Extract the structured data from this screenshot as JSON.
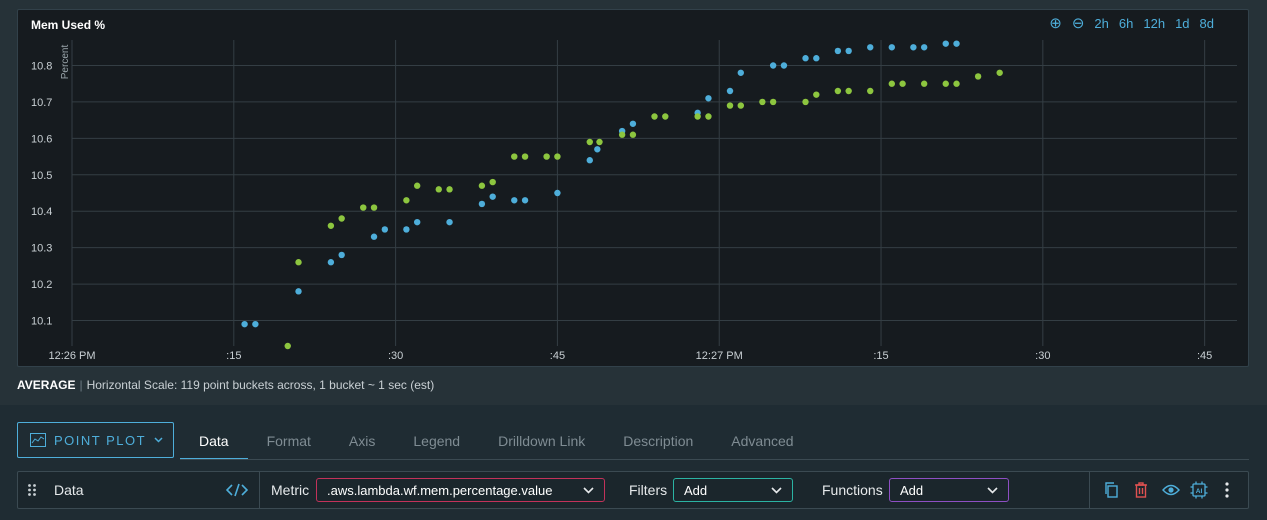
{
  "chart": {
    "title": "Mem Used %",
    "range_buttons": [
      "2h",
      "6h",
      "12h",
      "1d",
      "8d"
    ]
  },
  "chart_data": {
    "type": "scatter",
    "ylabel": "Percent",
    "xlabel": "",
    "ylim": [
      10.03,
      10.87
    ],
    "y_ticks": [
      10.1,
      10.2,
      10.3,
      10.4,
      10.5,
      10.6,
      10.7,
      10.8
    ],
    "x_range_seconds": [
      0,
      108
    ],
    "x_ticks": [
      {
        "t": 0,
        "label": "12:26 PM"
      },
      {
        "t": 15,
        "label": ":15"
      },
      {
        "t": 30,
        "label": ":30"
      },
      {
        "t": 45,
        "label": ":45"
      },
      {
        "t": 60,
        "label": "12:27 PM"
      },
      {
        "t": 75,
        "label": ":15"
      },
      {
        "t": 90,
        "label": ":30"
      },
      {
        "t": 105,
        "label": ":45"
      }
    ],
    "grid": true,
    "series": [
      {
        "color": "#4eaeda",
        "points": [
          [
            16,
            10.09
          ],
          [
            17,
            10.09
          ],
          [
            21,
            10.18
          ],
          [
            24,
            10.26
          ],
          [
            25,
            10.28
          ],
          [
            28,
            10.33
          ],
          [
            29,
            10.35
          ],
          [
            31,
            10.35
          ],
          [
            32,
            10.37
          ],
          [
            35,
            10.37
          ],
          [
            38,
            10.42
          ],
          [
            39,
            10.44
          ],
          [
            41,
            10.43
          ],
          [
            42,
            10.43
          ],
          [
            45,
            10.45
          ],
          [
            48,
            10.54
          ],
          [
            48.7,
            10.57
          ],
          [
            51,
            10.62
          ],
          [
            52,
            10.64
          ],
          [
            58,
            10.67
          ],
          [
            59,
            10.71
          ],
          [
            61,
            10.73
          ],
          [
            62,
            10.78
          ],
          [
            65,
            10.8
          ],
          [
            66,
            10.8
          ],
          [
            68,
            10.82
          ],
          [
            69,
            10.82
          ],
          [
            71,
            10.84
          ],
          [
            72,
            10.84
          ],
          [
            74,
            10.85
          ],
          [
            76,
            10.85
          ],
          [
            78,
            10.85
          ],
          [
            79,
            10.85
          ],
          [
            81,
            10.86
          ],
          [
            82,
            10.86
          ]
        ]
      },
      {
        "color": "#8dc63f",
        "points": [
          [
            20,
            10.03
          ],
          [
            21,
            10.26
          ],
          [
            24,
            10.36
          ],
          [
            25,
            10.38
          ],
          [
            27,
            10.41
          ],
          [
            28,
            10.41
          ],
          [
            31,
            10.43
          ],
          [
            32,
            10.47
          ],
          [
            34,
            10.46
          ],
          [
            35,
            10.46
          ],
          [
            38,
            10.47
          ],
          [
            39,
            10.48
          ],
          [
            41,
            10.55
          ],
          [
            42,
            10.55
          ],
          [
            44,
            10.55
          ],
          [
            45,
            10.55
          ],
          [
            48,
            10.59
          ],
          [
            48.9,
            10.59
          ],
          [
            51,
            10.61
          ],
          [
            52,
            10.61
          ],
          [
            54,
            10.66
          ],
          [
            55,
            10.66
          ],
          [
            58,
            10.66
          ],
          [
            59,
            10.66
          ],
          [
            61,
            10.69
          ],
          [
            62,
            10.69
          ],
          [
            64,
            10.7
          ],
          [
            65,
            10.7
          ],
          [
            68,
            10.7
          ],
          [
            69,
            10.72
          ],
          [
            71,
            10.73
          ],
          [
            72,
            10.73
          ],
          [
            74,
            10.73
          ],
          [
            76,
            10.75
          ],
          [
            77,
            10.75
          ],
          [
            79,
            10.75
          ],
          [
            81,
            10.75
          ],
          [
            82,
            10.75
          ],
          [
            84,
            10.77
          ],
          [
            86,
            10.78
          ]
        ]
      }
    ]
  },
  "summary": {
    "mode": "AVERAGE",
    "scale_text": "Horizontal Scale: 119 point buckets across, 1 bucket ~ 1 sec (est)"
  },
  "editor": {
    "plot_type_label": "POINT PLOT",
    "tabs": [
      "Data",
      "Format",
      "Axis",
      "Legend",
      "Drilldown Link",
      "Description",
      "Advanced"
    ],
    "active_tab": "Data",
    "row": {
      "name": "Data",
      "metric_label": "Metric",
      "metric_value": ".aws.lambda.wf.mem.percentage.value",
      "filters_label": "Filters",
      "filters_value": "Add",
      "functions_label": "Functions",
      "functions_value": "Add"
    }
  },
  "colors": {
    "accent": "#4eaeda",
    "series_blue": "#4eaeda",
    "series_green": "#8dc63f",
    "metric_border": "#c2325a",
    "filters_border": "#2bb3a3",
    "functions_border": "#8e4fc4",
    "delete_icon": "#e05252"
  },
  "icons": {
    "zoom_in": "zoom-in-icon",
    "zoom_out": "zoom-out-icon",
    "drag_handle": "drag-handle-icon",
    "code": "code-icon",
    "copy": "copy-icon",
    "delete": "trash-icon",
    "visibility": "eye-icon",
    "ai": "ai-chip-icon",
    "more": "kebab-menu-icon"
  }
}
